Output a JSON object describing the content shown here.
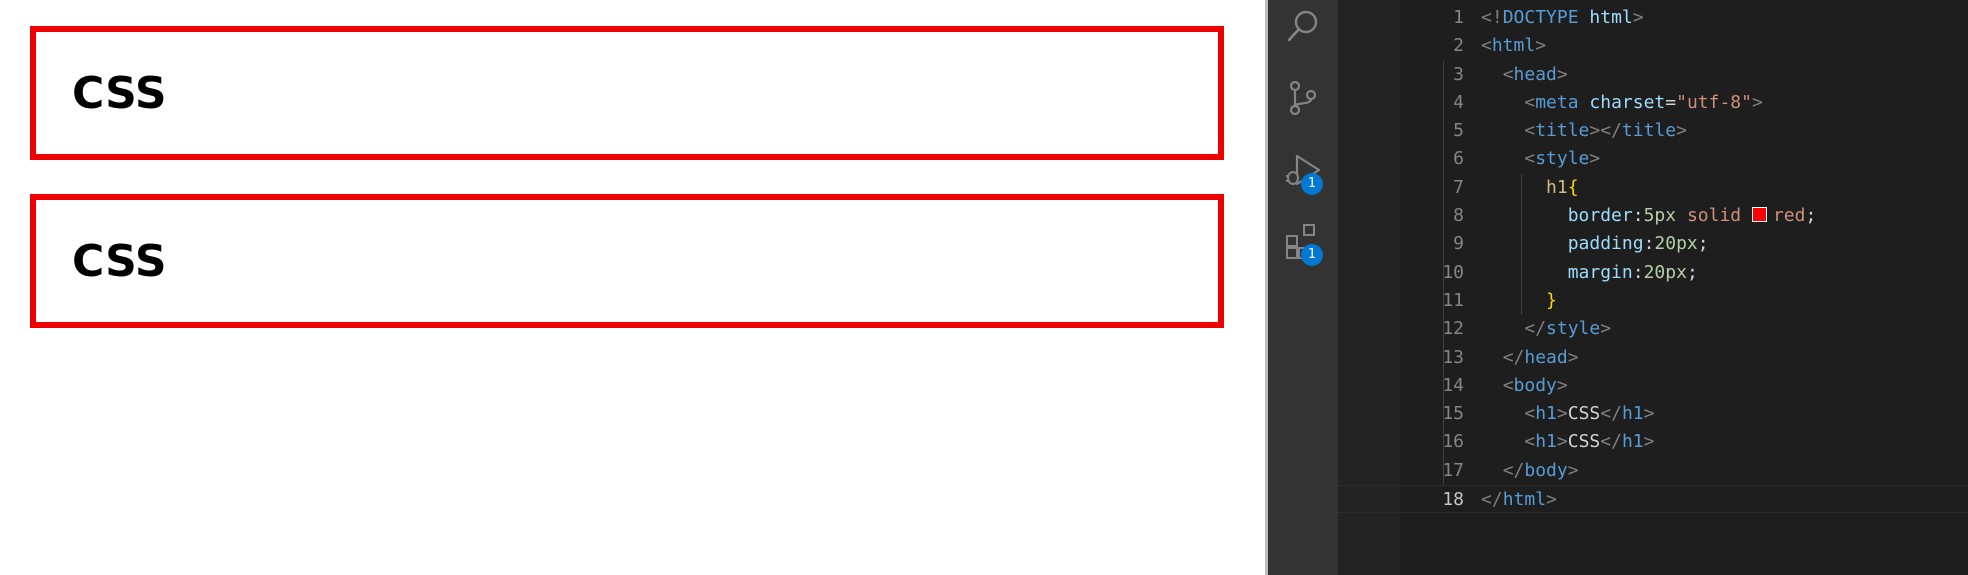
{
  "preview": {
    "headings": [
      "CSS",
      "CSS"
    ],
    "border_color": "#ee0000"
  },
  "activity_bar": {
    "items": [
      {
        "name": "search-icon"
      },
      {
        "name": "source-control-icon"
      },
      {
        "name": "run-debug-icon",
        "badge": "1"
      },
      {
        "name": "extensions-icon",
        "badge": "1"
      }
    ]
  },
  "editor": {
    "active_line": "18",
    "lines": [
      {
        "n": "1",
        "tokens": [
          [
            "br",
            "<!"
          ],
          [
            "tag",
            "DOCTYPE"
          ],
          [
            "txt",
            " "
          ],
          [
            "attr",
            "html"
          ],
          [
            "br",
            ">"
          ]
        ]
      },
      {
        "n": "2",
        "tokens": [
          [
            "br",
            "<"
          ],
          [
            "tag",
            "html"
          ],
          [
            "br",
            ">"
          ]
        ]
      },
      {
        "n": "3",
        "tokens": [
          [
            "txt",
            "  "
          ],
          [
            "br",
            "<"
          ],
          [
            "tag",
            "head"
          ],
          [
            "br",
            ">"
          ]
        ]
      },
      {
        "n": "4",
        "tokens": [
          [
            "txt",
            "    "
          ],
          [
            "br",
            "<"
          ],
          [
            "tag",
            "meta"
          ],
          [
            "txt",
            " "
          ],
          [
            "attr",
            "charset"
          ],
          [
            "txt",
            "="
          ],
          [
            "str",
            "\"utf-8\""
          ],
          [
            "br",
            ">"
          ]
        ]
      },
      {
        "n": "5",
        "tokens": [
          [
            "txt",
            "    "
          ],
          [
            "br",
            "<"
          ],
          [
            "tag",
            "title"
          ],
          [
            "br",
            "></"
          ],
          [
            "tag",
            "title"
          ],
          [
            "br",
            ">"
          ]
        ]
      },
      {
        "n": "6",
        "tokens": [
          [
            "txt",
            "    "
          ],
          [
            "br",
            "<"
          ],
          [
            "tag",
            "style"
          ],
          [
            "br",
            ">"
          ]
        ]
      },
      {
        "n": "7",
        "tokens": [
          [
            "txt",
            "      "
          ],
          [
            "sel",
            "h1"
          ],
          [
            "brace",
            "{"
          ]
        ]
      },
      {
        "n": "8",
        "tokens": [
          [
            "txt",
            "        "
          ],
          [
            "prop",
            "border"
          ],
          [
            "txt",
            ":"
          ],
          [
            "num",
            "5px"
          ],
          [
            "txt",
            " "
          ],
          [
            "val",
            "solid"
          ],
          [
            "txt",
            " "
          ],
          [
            "swatch",
            ""
          ],
          [
            "val",
            "red"
          ],
          [
            "txt",
            ";"
          ]
        ]
      },
      {
        "n": "9",
        "tokens": [
          [
            "txt",
            "        "
          ],
          [
            "prop",
            "padding"
          ],
          [
            "txt",
            ":"
          ],
          [
            "num",
            "20px"
          ],
          [
            "txt",
            ";"
          ]
        ]
      },
      {
        "n": "10",
        "tokens": [
          [
            "txt",
            "        "
          ],
          [
            "prop",
            "margin"
          ],
          [
            "txt",
            ":"
          ],
          [
            "num",
            "20px"
          ],
          [
            "txt",
            ";"
          ]
        ]
      },
      {
        "n": "11",
        "tokens": [
          [
            "txt",
            "      "
          ],
          [
            "brace",
            "}"
          ]
        ]
      },
      {
        "n": "12",
        "tokens": [
          [
            "txt",
            "    "
          ],
          [
            "br",
            "</"
          ],
          [
            "tag",
            "style"
          ],
          [
            "br",
            ">"
          ]
        ]
      },
      {
        "n": "13",
        "tokens": [
          [
            "txt",
            "  "
          ],
          [
            "br",
            "</"
          ],
          [
            "tag",
            "head"
          ],
          [
            "br",
            ">"
          ]
        ]
      },
      {
        "n": "14",
        "tokens": [
          [
            "txt",
            "  "
          ],
          [
            "br",
            "<"
          ],
          [
            "tag",
            "body"
          ],
          [
            "br",
            ">"
          ]
        ]
      },
      {
        "n": "15",
        "tokens": [
          [
            "txt",
            "    "
          ],
          [
            "br",
            "<"
          ],
          [
            "tag",
            "h1"
          ],
          [
            "br",
            ">"
          ],
          [
            "txt",
            "CSS"
          ],
          [
            "br",
            "</"
          ],
          [
            "tag",
            "h1"
          ],
          [
            "br",
            ">"
          ]
        ]
      },
      {
        "n": "16",
        "tokens": [
          [
            "txt",
            "    "
          ],
          [
            "br",
            "<"
          ],
          [
            "tag",
            "h1"
          ],
          [
            "br",
            ">"
          ],
          [
            "txt",
            "CSS"
          ],
          [
            "br",
            "</"
          ],
          [
            "tag",
            "h1"
          ],
          [
            "br",
            ">"
          ]
        ]
      },
      {
        "n": "17",
        "tokens": [
          [
            "txt",
            "  "
          ],
          [
            "br",
            "</"
          ],
          [
            "tag",
            "body"
          ],
          [
            "br",
            ">"
          ]
        ]
      },
      {
        "n": "18",
        "tokens": [
          [
            "br",
            "</"
          ],
          [
            "tag",
            "html"
          ],
          [
            "br",
            ">"
          ]
        ]
      }
    ]
  }
}
